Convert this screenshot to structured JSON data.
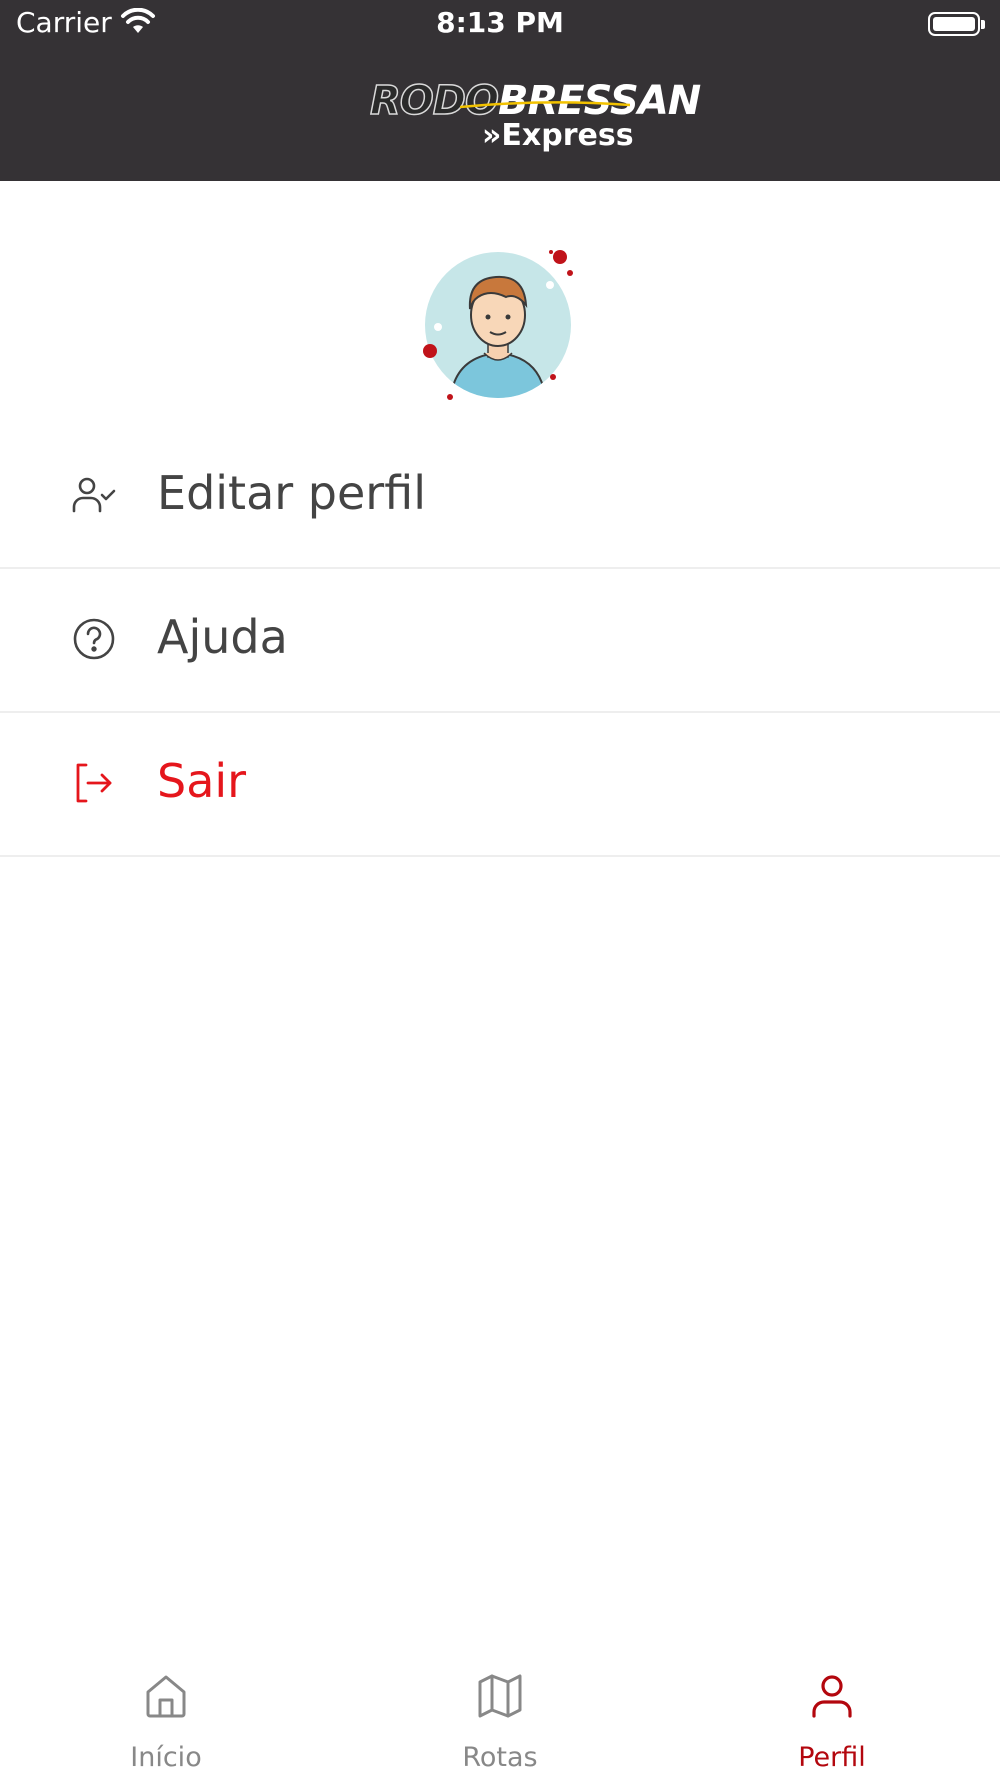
{
  "status_bar": {
    "carrier": "Carrier",
    "time": "8:13 PM"
  },
  "header": {
    "logo_word_1": "RODO",
    "logo_word_2": "BRESSAN",
    "logo_sub": "»Express"
  },
  "profile": {
    "avatar_icon": "user-avatar-illustration"
  },
  "menu": {
    "items": [
      {
        "label": "Editar perfil",
        "icon": "user-check-icon"
      },
      {
        "label": "Ajuda",
        "icon": "help-circle-icon"
      },
      {
        "label": "Sair",
        "icon": "log-out-icon",
        "color": "#e5161c"
      }
    ]
  },
  "tabbar": {
    "tabs": [
      {
        "label": "Início",
        "icon": "home-icon",
        "active": false
      },
      {
        "label": "Rotas",
        "icon": "map-icon",
        "active": false
      },
      {
        "label": "Perfil",
        "icon": "user-icon",
        "active": true
      }
    ]
  },
  "colors": {
    "header_bg": "#353235",
    "accent": "#b3070e",
    "danger": "#e5161c",
    "inactive": "#888888"
  }
}
